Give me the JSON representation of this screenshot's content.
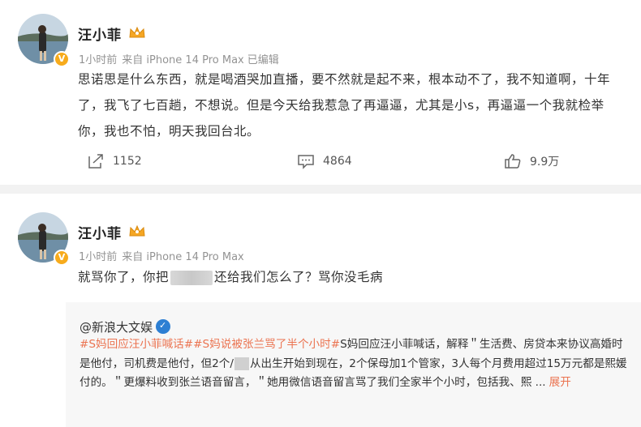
{
  "post1": {
    "author": "汪小菲",
    "time": "1小时前",
    "source": "来自 iPhone 14 Pro Max",
    "edited": "已编辑",
    "text": "思诺思是什么东西，就是喝酒哭加直播，要不然就是起不来，根本动不了，我不知道啊，十年了，我飞了七百趟，不想说。但是今天给我惹急了再逼逼，尤其是小s，再逼逼一个我就检举你，我也不怕，明天我回台北。",
    "reposts": "1152",
    "comments": "4864",
    "likes": "9.9万"
  },
  "post2": {
    "author": "汪小菲",
    "time": "1小时前",
    "source": "来自 iPhone 14 Pro Max",
    "text_before": "就骂你了，你把",
    "text_after": "还给我们怎么了？骂你没毛病"
  },
  "repost": {
    "author": "@新浪大文娱",
    "tag1": "#S妈回应汪小菲喊话#",
    "tag2": "#S妈说被张兰骂了半个小时#",
    "text_a": "S妈回应汪小菲喊话，解释＂生活费、房贷本来协议高婚时是他付，司机费是他付，但2个/",
    "text_b": "从出生开始到现在，2个保母加1个管家，3人每个月费用超过15万元都是熙媛付的。＂更爆料收到张兰语音留言，＂她用微信语音留言骂了我们全家半个小时，包括我、熙 ...",
    "expand": "展开"
  },
  "colors": {
    "accent": "#eb7350",
    "badge": "#f7ab1c",
    "meta": "#939393"
  }
}
